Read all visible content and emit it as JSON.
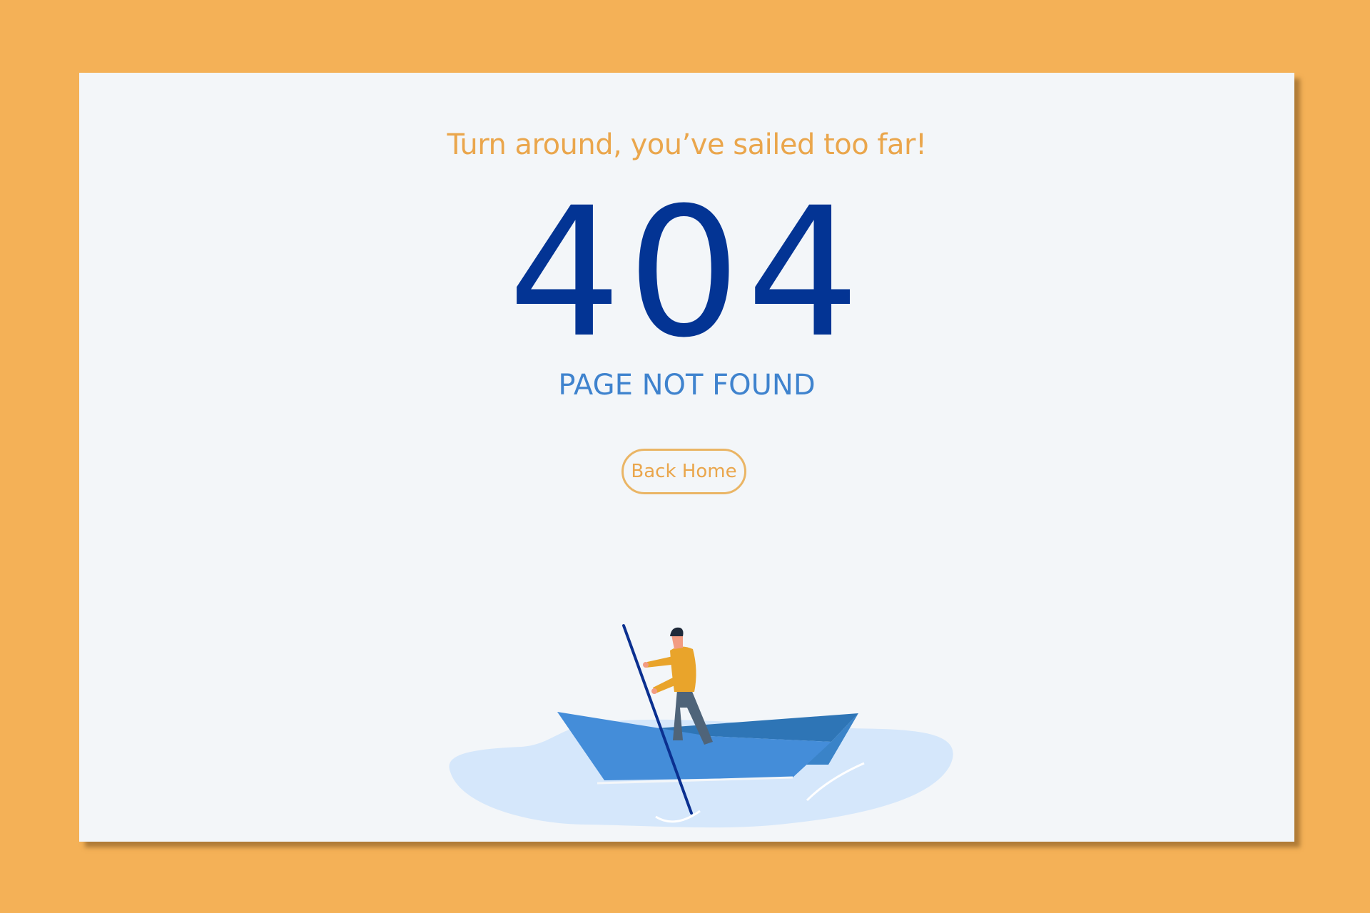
{
  "card": {
    "tagline": "Turn around, you’ve sailed too far!",
    "error_code": "404",
    "subtitle": "PAGE NOT FOUND",
    "back_button_label": "Back Home"
  },
  "illustration": {
    "subject": "person-rowing-paper-boat",
    "colors": {
      "water": "#D5E7FB",
      "boat_front": "#448DD9",
      "boat_back": "#2E75B6",
      "pole": "#0B3090",
      "shirt": "#E9A42B",
      "pants": "#4F6479"
    }
  },
  "colors": {
    "background": "#F4B157",
    "card": "#F3F6F9",
    "accent_orange": "#EAA64C",
    "code_blue": "#033494",
    "subtitle_blue": "#3F83CE"
  }
}
